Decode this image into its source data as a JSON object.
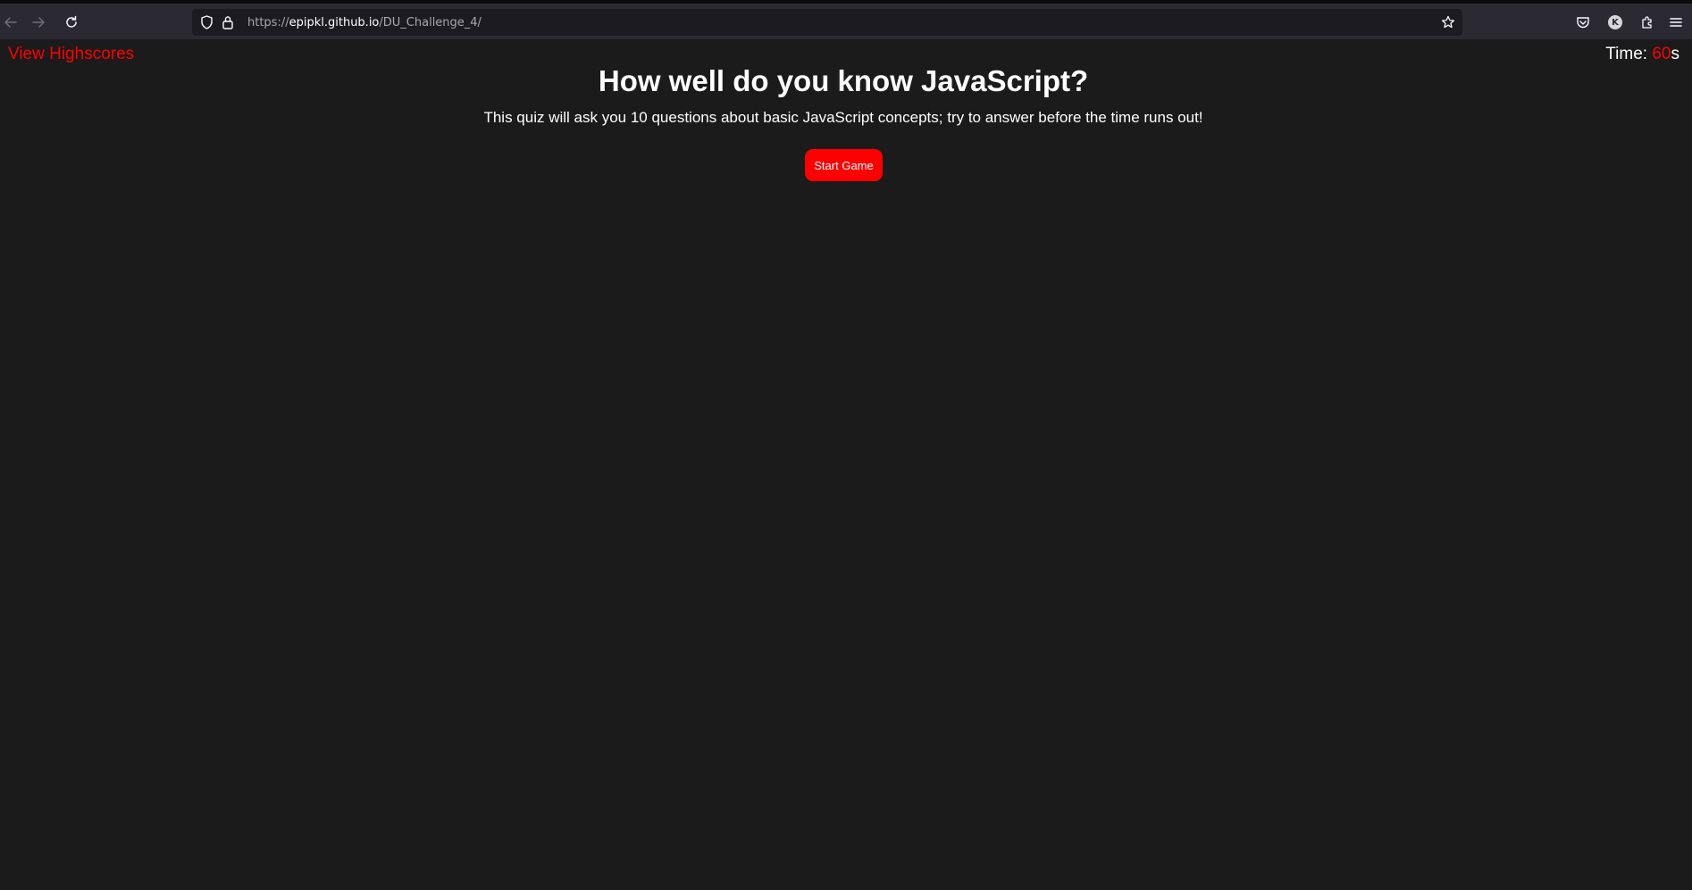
{
  "browser": {
    "url_scheme": "https://",
    "url_host": "epipkl.github.io",
    "url_path": "/DU_Challenge_4/",
    "profile_initial": "K",
    "icons": {
      "back": "back-arrow-icon",
      "forward": "forward-arrow-icon",
      "reload": "reload-icon",
      "tracking": "shield-icon",
      "security": "lock-icon",
      "bookmark": "star-icon",
      "pocket": "pocket-icon",
      "account": "account-avatar-icon",
      "extensions": "puzzle-icon",
      "menu": "hamburger-menu-icon"
    }
  },
  "header": {
    "highscores_link": "View Highscores",
    "time_label": "Time: ",
    "time_value": "60",
    "time_unit": "s"
  },
  "main": {
    "title": "How well do you know JavaScript?",
    "description": "This quiz will ask you 10 questions about basic JavaScript concepts; try to answer before the time runs out!",
    "start_button": "Start Game"
  },
  "colors": {
    "background": "#1b1b1b",
    "accent": "#ff0000",
    "text": "#ffffff"
  }
}
